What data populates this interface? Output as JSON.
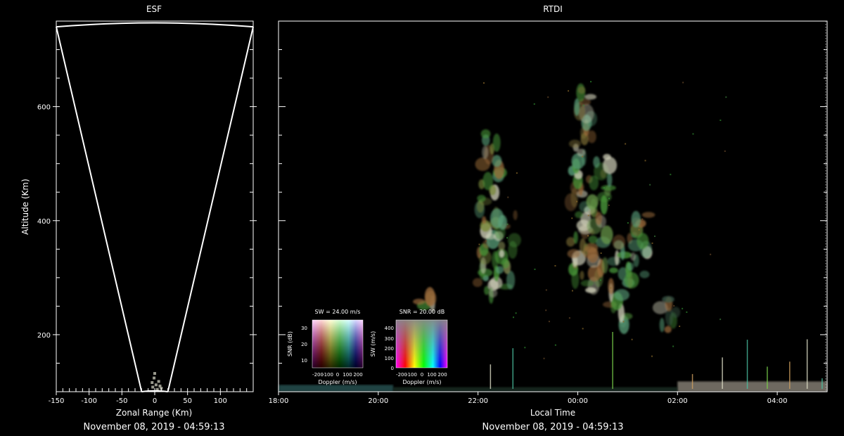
{
  "chart_data": [
    {
      "type": "scatter",
      "title": "ESF",
      "xlabel": "Zonal Range (Km)",
      "ylabel": "Altitude (Km)",
      "footer": "November 08, 2019 - 04:59:13",
      "xlim": [
        -150,
        150
      ],
      "ylim": [
        100,
        750
      ],
      "x_ticks": [
        -150,
        -100,
        -50,
        0,
        50,
        100
      ],
      "y_ticks": [
        200,
        400,
        600
      ],
      "x_tick_labels": [
        "-150",
        "-100",
        "-50",
        "0",
        "50",
        "100"
      ],
      "y_tick_labels": [
        "200",
        "400",
        "600"
      ],
      "beam_edges": {
        "left_angle_deg": -11,
        "right_angle_deg": 11,
        "max_range_km": 750
      },
      "echo_points": [
        {
          "x": -3,
          "y": 108
        },
        {
          "x": 2,
          "y": 112
        },
        {
          "x": 6,
          "y": 118
        },
        {
          "x": -1,
          "y": 124
        },
        {
          "x": 4,
          "y": 104
        },
        {
          "x": 8,
          "y": 110
        },
        {
          "x": 0,
          "y": 132
        },
        {
          "x": -4,
          "y": 116
        },
        {
          "x": 10,
          "y": 106
        }
      ]
    },
    {
      "type": "heatmap",
      "title": "RTDI",
      "xlabel": "Local Time",
      "ylabel": "",
      "footer": "November 08, 2019 - 04:59:13",
      "xlim_hours": [
        18,
        29
      ],
      "ylim": [
        100,
        750
      ],
      "x_ticks_hours": [
        18,
        20,
        22,
        24,
        26,
        28
      ],
      "x_tick_labels": [
        "18:00",
        "20:00",
        "22:00",
        "00:00",
        "02:00",
        "04:00"
      ],
      "plumes": [
        {
          "t": 22.15,
          "alt_low": 280,
          "alt_high": 560,
          "color": "#7a8a3a"
        },
        {
          "t": 22.45,
          "alt_low": 270,
          "alt_high": 420,
          "color": "#9aa060"
        },
        {
          "t": 24.0,
          "alt_low": 300,
          "alt_high": 640,
          "color": "#8a7a3a"
        },
        {
          "t": 24.35,
          "alt_low": 280,
          "alt_high": 520,
          "color": "#6a9a4a"
        },
        {
          "t": 24.8,
          "alt_low": 220,
          "alt_high": 380,
          "color": "#4a8a3a"
        },
        {
          "t": 25.2,
          "alt_low": 300,
          "alt_high": 420,
          "color": "#2f7a3a"
        },
        {
          "t": 20.9,
          "alt_low": 255,
          "alt_high": 275,
          "color": "#3a6a2a"
        },
        {
          "t": 25.75,
          "alt_low": 210,
          "alt_high": 270,
          "color": "#3a5a4a"
        }
      ],
      "legends": [
        {
          "title": "SW = 24.00 m/s",
          "xlabel": "Doppler (m/s)",
          "ylabel": "SNR (dB)",
          "x_ticks": [
            "-200",
            "-100",
            "0",
            "100",
            "200"
          ],
          "y_ticks": [
            "10",
            "20",
            "30"
          ]
        },
        {
          "title": "SNR = 20.00 dB",
          "xlabel": "Doppler (m/s)",
          "ylabel": "SW (m/s)",
          "x_ticks": [
            "-200",
            "-100",
            "0",
            "100",
            "200"
          ],
          "y_ticks": [
            "0",
            "100",
            "200",
            "300",
            "400"
          ]
        }
      ]
    }
  ]
}
